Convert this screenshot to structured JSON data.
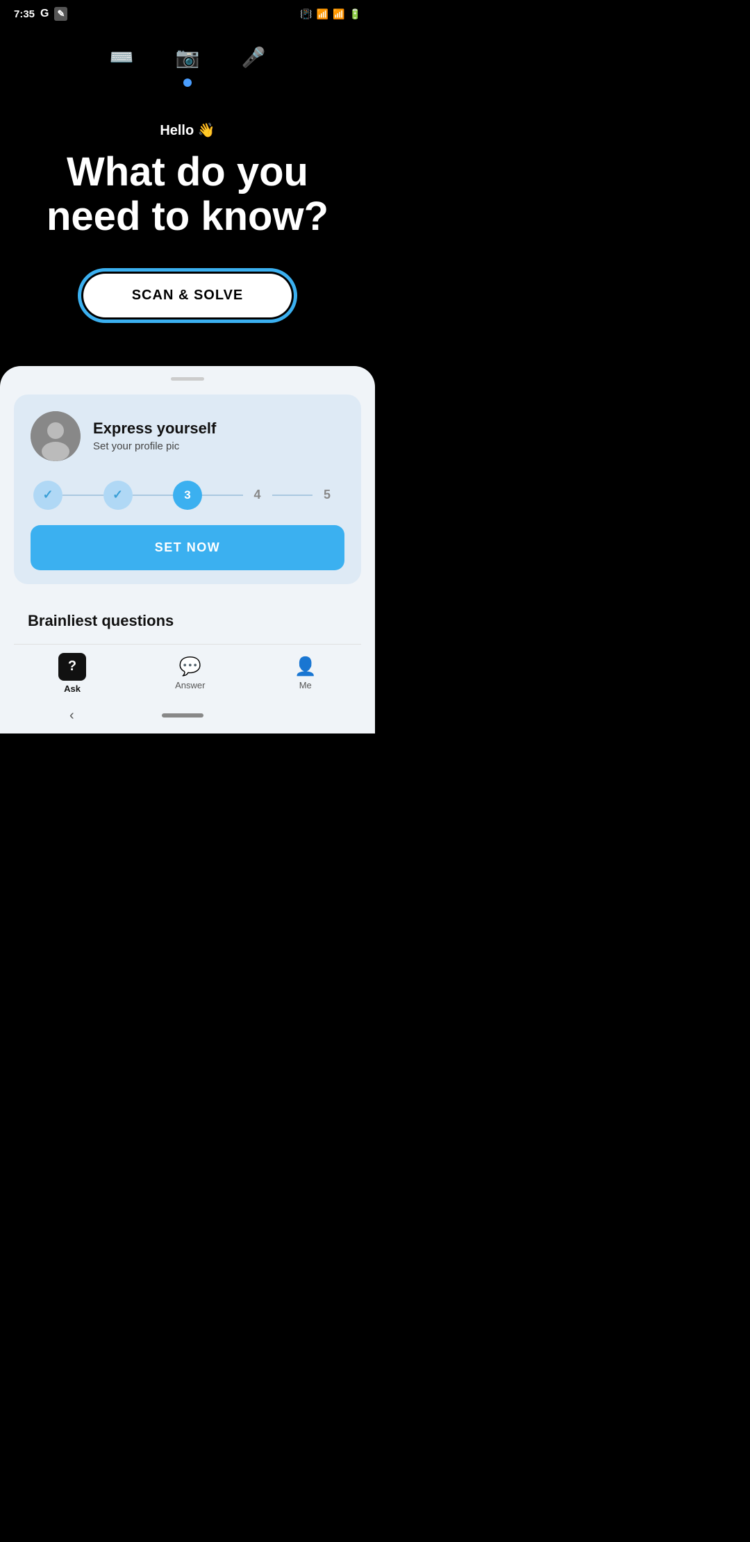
{
  "statusBar": {
    "time": "7:35",
    "batteryIcon": "🔋"
  },
  "inputIcons": {
    "keyboard": "⌨",
    "camera": "📷",
    "mic": "🎤"
  },
  "hero": {
    "greeting": "Hello 👋",
    "heading": "What do you need to know?",
    "scanSolveLabel": "SCAN & SOLVE"
  },
  "profileCard": {
    "title": "Express yourself",
    "subtitle": "Set your profile pic",
    "steps": [
      {
        "id": 1,
        "state": "done",
        "label": "✓"
      },
      {
        "id": 2,
        "state": "done",
        "label": "✓"
      },
      {
        "id": 3,
        "state": "active",
        "label": "3"
      },
      {
        "id": 4,
        "state": "inactive",
        "label": "4"
      },
      {
        "id": 5,
        "state": "inactive",
        "label": "5"
      }
    ],
    "setNowLabel": "SET NOW"
  },
  "brainliest": {
    "title": "Brainliest questions"
  },
  "bottomNav": {
    "items": [
      {
        "id": "ask",
        "label": "Ask",
        "active": true
      },
      {
        "id": "answer",
        "label": "Answer",
        "active": false
      },
      {
        "id": "me",
        "label": "Me",
        "active": false
      }
    ]
  }
}
